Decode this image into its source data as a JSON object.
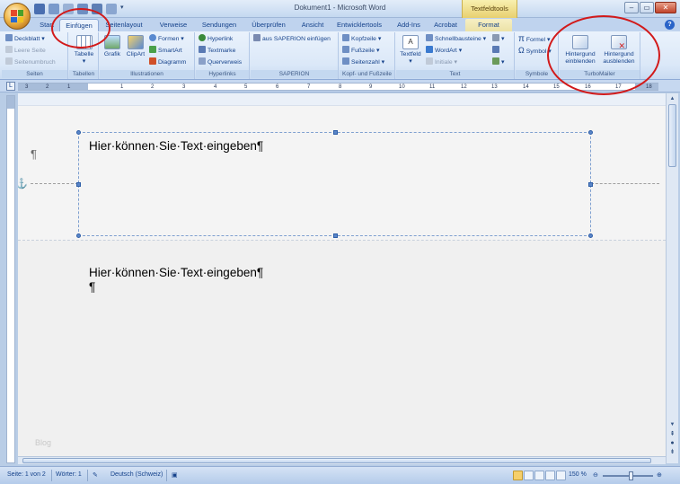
{
  "window": {
    "title": "Dokument1 - Microsoft Word",
    "context_tab_group": "Textfeldtools"
  },
  "tabs": [
    "Start",
    "Einfügen",
    "Seitenlayout",
    "Verweise",
    "Sendungen",
    "Überprüfen",
    "Ansicht",
    "Entwicklertools",
    "Add-Ins",
    "Acrobat",
    "Format"
  ],
  "active_tab": "Einfügen",
  "ribbon": {
    "seiten": {
      "label": "Seiten",
      "deckblatt": "Deckblatt",
      "leere_seite": "Leere Seite",
      "seitenumbruch": "Seitenumbruch"
    },
    "tabellen": {
      "label": "Tabellen",
      "tabelle": "Tabelle"
    },
    "illustrationen": {
      "label": "Illustrationen",
      "grafik": "Grafik",
      "clipart": "ClipArt",
      "formen": "Formen",
      "smartart": "SmartArt",
      "diagramm": "Diagramm"
    },
    "hyperlinks": {
      "label": "Hyperlinks",
      "hyperlink": "Hyperlink",
      "textmarke": "Textmarke",
      "querverweis": "Querverweis"
    },
    "saperion": {
      "label": "SAPERION",
      "einfuegen": "aus SAPERION einfügen"
    },
    "kopf_fuss": {
      "label": "Kopf- und Fußzeile",
      "kopfzeile": "Kopfzeile",
      "fusszeile": "Fußzeile",
      "seitenzahl": "Seitenzahl"
    },
    "text": {
      "label": "Text",
      "textfeld": "Textfeld",
      "schnellbausteine": "Schnellbausteine",
      "wordart": "WordArt",
      "initiale": "Initiale"
    },
    "symbole": {
      "label": "Symbole",
      "formel": "Formel",
      "symbol": "Symbol"
    },
    "turbomailer": {
      "label": "TurboMailer",
      "einblenden_1": "Hintergund",
      "einblenden_2": "einblenden",
      "ausblenden_1": "Hintergund",
      "ausblenden_2": "ausblenden"
    }
  },
  "ruler": {
    "numbers": [
      "3",
      "2",
      "1",
      "1",
      "2",
      "3",
      "4",
      "5",
      "6",
      "7",
      "8",
      "9",
      "10",
      "11",
      "12",
      "13",
      "14",
      "15",
      "16",
      "17",
      "18"
    ]
  },
  "document": {
    "textbox_text": "Hier·können·Sie·Text·eingeben¶",
    "body_line1": "Hier·können·Sie·Text·eingeben¶",
    "body_line2": "¶",
    "header_para_mark": "¶",
    "anchor": "⚓",
    "watermark": "Blog"
  },
  "statusbar": {
    "page": "Seite: 1 von 2",
    "words": "Wörter: 1",
    "language": "Deutsch (Schweiz)",
    "zoom": "150 %"
  },
  "colors": {
    "annotation_circle": "#d21a1a",
    "ribbon_bg": "#dbe8f8",
    "context_tab": "#e8d070"
  }
}
